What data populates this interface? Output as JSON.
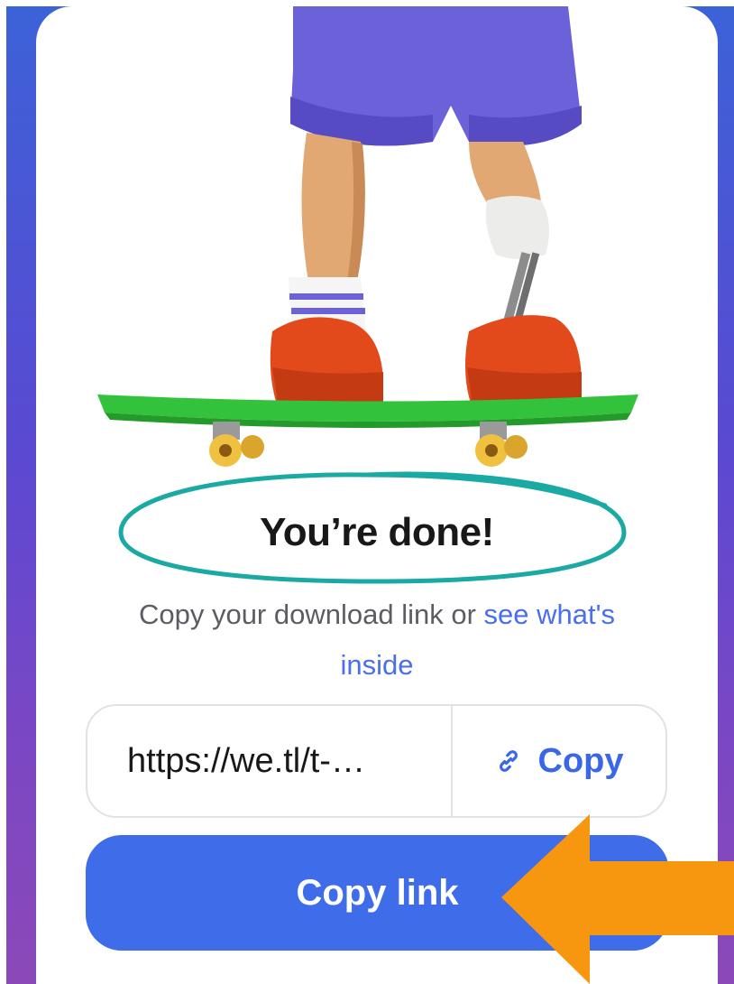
{
  "done": {
    "headline": "You’re done!",
    "subtitle_prefix": "Copy your download link or ",
    "subtitle_link": "see what's inside"
  },
  "link_box": {
    "url": "https://we.tl/t-…",
    "copy_label": "Copy"
  },
  "primary_button": {
    "label": "Copy link"
  },
  "colors": {
    "accent": "#3f6ce9",
    "link": "#4a6ef0",
    "scribble": "#1aa9a3",
    "arrow": "#f7970f",
    "skateboard": "#32c23b",
    "shoes": "#e24a1b",
    "shorts": "#6b61d8"
  },
  "icons": [
    "link-icon"
  ]
}
